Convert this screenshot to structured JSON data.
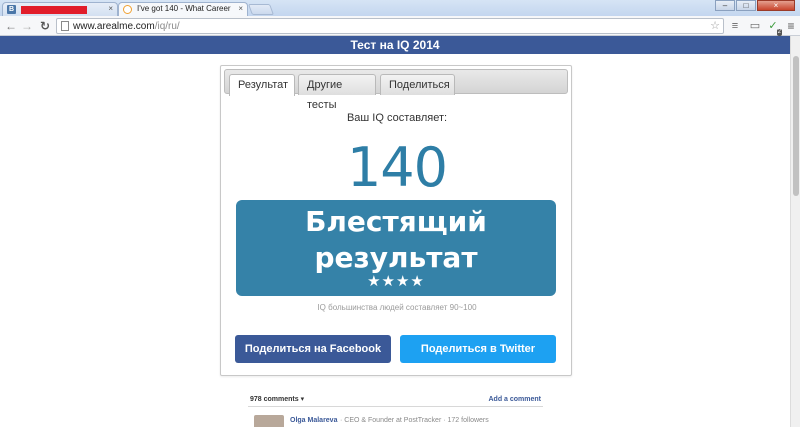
{
  "browser": {
    "tabs": [
      {
        "label": "",
        "favicon": "В",
        "close": "×"
      },
      {
        "label": "I've got 140 - What Career",
        "close": "×"
      }
    ],
    "url_domain": "www.arealme.com",
    "url_path": "/iq/ru/",
    "window_controls": {
      "minimize": "–",
      "maximize": "□",
      "close": "×"
    },
    "extension_badge": "2"
  },
  "page": {
    "header_title": "Тест на IQ 2014",
    "tabs": [
      "Результат",
      "Другие тесты",
      "Поделиться"
    ],
    "iq_label": "Ваш IQ составляет:",
    "iq_score": "140",
    "result_title_line1": "Блестящий",
    "result_title_line2": "результат",
    "result_stars": "★★★★",
    "iq_note": "IQ большинства людей составляет 90~100",
    "share_facebook": "Поделиться на Facebook",
    "share_twitter": "Поделиться в Twitter"
  },
  "comments": {
    "count_label": "978 comments ▾",
    "add_label": "Add a comment",
    "first_author": "Olga Malareva",
    "first_meta": "· CEO & Founder at PostTracker · 172 followers"
  },
  "colors": {
    "header_bg": "#3b5998",
    "score_color": "#2e7ea6",
    "result_bg": "#3582a8",
    "facebook": "#3b5998",
    "twitter": "#1da1f2"
  }
}
